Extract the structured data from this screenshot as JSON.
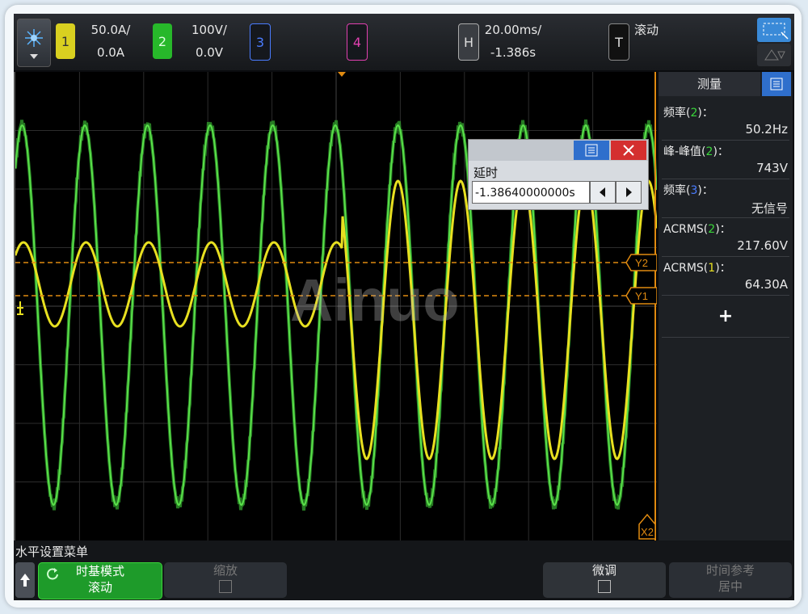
{
  "top": {
    "ch1": {
      "num": "1",
      "scale": "50.0A/",
      "offset": "0.0A"
    },
    "ch2": {
      "num": "2",
      "scale": "100V/",
      "offset": "0.0V"
    },
    "ch3": {
      "num": "3"
    },
    "ch4": {
      "num": "4"
    },
    "horizontal": {
      "label": "H",
      "scale": "20.00ms/",
      "delay": "-1.386s"
    },
    "trigger": {
      "label": "T",
      "mode": "滚动"
    }
  },
  "plot": {
    "markers": {
      "y2": "Y2",
      "y1": "Y1",
      "x2": "X2"
    },
    "watermark": "Ainuo"
  },
  "delay_dialog": {
    "title": "延时",
    "value": "-1.38640000000s"
  },
  "measurements": {
    "title": "测量",
    "items": [
      {
        "label_pre": "频率(",
        "ch": "2",
        "label_post": ")：",
        "value": "50.2Hz",
        "color": "#3ad63a"
      },
      {
        "label_pre": "峰-峰值(",
        "ch": "2",
        "label_post": ")：",
        "value": "743V",
        "color": "#3ad63a"
      },
      {
        "label_pre": "频率(",
        "ch": "3",
        "label_post": ")：",
        "value": "无信号",
        "color": "#4a7cff"
      },
      {
        "label_pre": "ACRMS(",
        "ch": "2",
        "label_post": ")：",
        "value": "217.60V",
        "color": "#3ad63a"
      },
      {
        "label_pre": "ACRMS(",
        "ch": "1",
        "label_post": ")：",
        "value": "64.30A",
        "color": "#e8e020"
      }
    ],
    "add": "+"
  },
  "menu": {
    "title": "水平设置菜单",
    "timebase_label": "时基模式",
    "timebase_value": "滚动",
    "zoom_label": "缩放",
    "fine_label": "微调",
    "timeref_label": "时间参考",
    "timeref_value": "居中"
  },
  "colors": {
    "ch1": "#e8e020",
    "ch2": "#3ad63a",
    "ch3": "#4a7cff",
    "ch4": "#e040b0",
    "cursor": "#e08a10"
  }
}
